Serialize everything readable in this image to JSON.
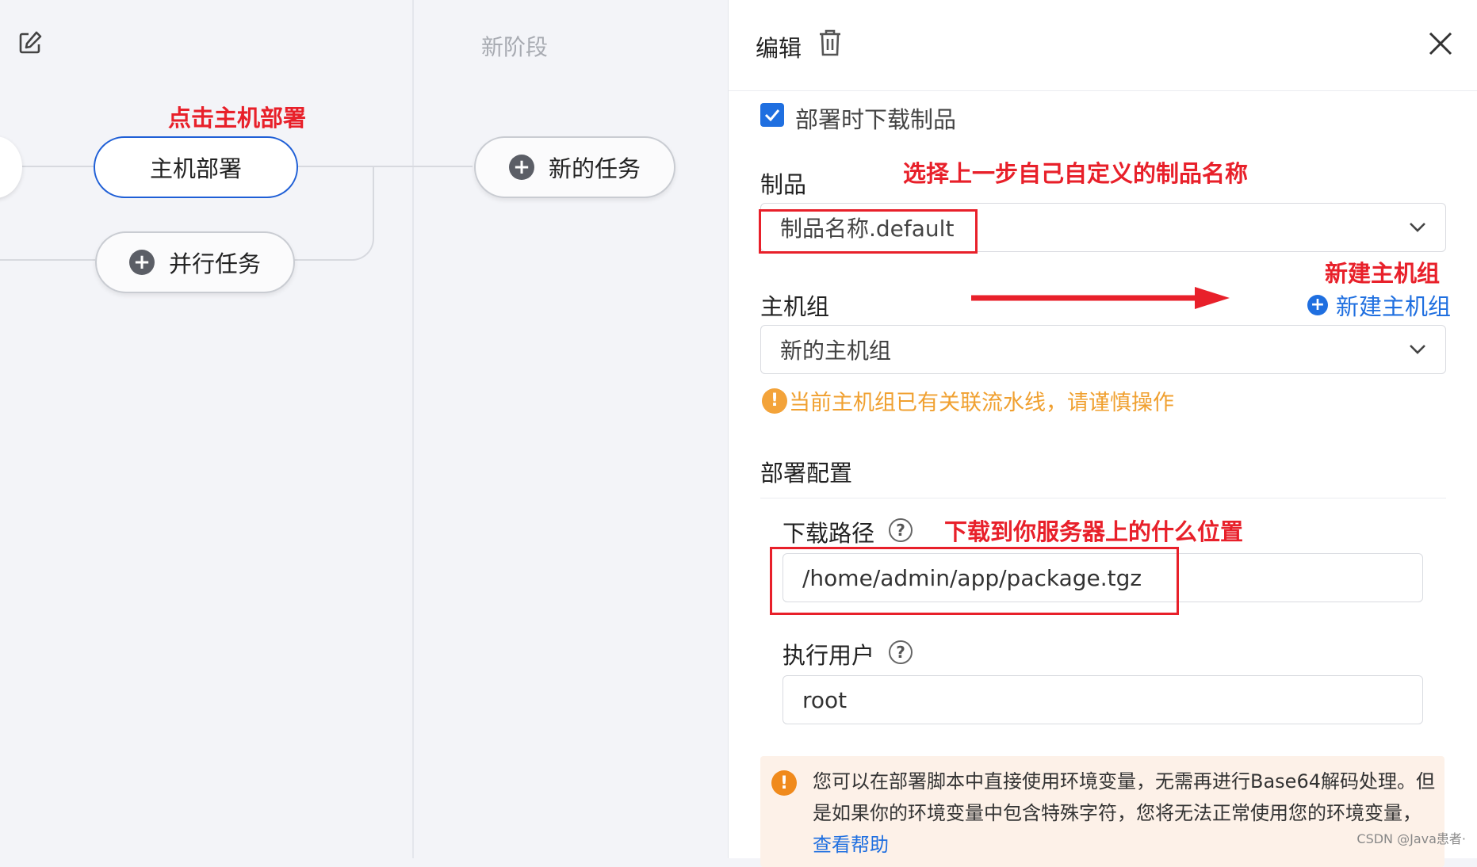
{
  "canvas": {
    "stage_title": "新阶段",
    "nodes": {
      "host_deploy": "主机部署",
      "parallel_task": "并行任务",
      "new_task": "新的任务"
    },
    "annotation_click": "点击主机部署"
  },
  "panel": {
    "title": "编辑",
    "checkbox_label": "部署时下载制品",
    "artifact_label": "制品",
    "artifact_value": "制品名称.default",
    "annotation_artifact": "选择上一步自己自定义的制品名称",
    "hostgroup_label": "主机组",
    "hostgroup_value": "新的主机组",
    "new_hostgroup_link": "新建主机组",
    "annotation_new_hostgroup": "新建主机组",
    "hostgroup_warning": "当前主机组已有关联流水线，请谨慎操作",
    "deploy_config_label": "部署配置",
    "download_path_label": "下载路径",
    "download_path_value": "/home/admin/app/package.tgz",
    "annotation_download_path": "下载到你服务器上的什么位置",
    "exec_user_label": "执行用户",
    "exec_user_value": "root",
    "notice_text": "您可以在部署脚本中直接使用环境变量，无需再进行Base64解码处理。但是如果你的环境变量中包含特殊字符，您将无法正常使用您的环境变量，",
    "notice_link": "查看帮助"
  },
  "watermark": "CSDN @Java患者·",
  "colors": {
    "accent": "#1f6fe0",
    "annotation_red": "#e8202a",
    "warning_orange": "#f0a030",
    "notice_bg": "#fdf1e8"
  },
  "icons": [
    "edit-icon",
    "trash-icon",
    "close-icon",
    "plus-icon",
    "chevron-down-icon",
    "help-icon",
    "warning-icon",
    "check-icon"
  ]
}
